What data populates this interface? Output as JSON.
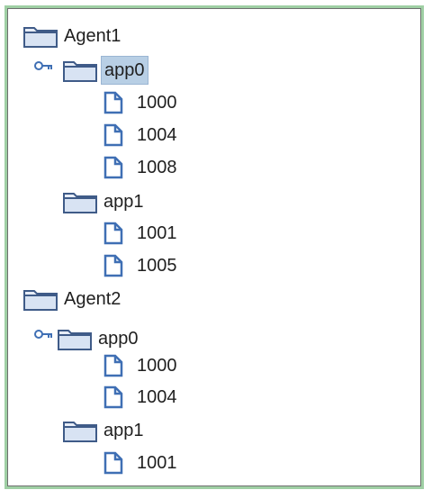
{
  "tree": {
    "agents": [
      {
        "label": "Agent1",
        "apps": [
          {
            "label": "app0",
            "selected": true,
            "files": [
              "1000",
              "1004",
              "1008"
            ]
          },
          {
            "label": "app1",
            "selected": false,
            "files": [
              "1001",
              "1005"
            ]
          }
        ]
      },
      {
        "label": "Agent2",
        "apps": [
          {
            "label": "app0",
            "selected": false,
            "files": [
              "1000",
              "1004"
            ]
          },
          {
            "label": "app1",
            "selected": false,
            "files": [
              "1001"
            ]
          }
        ]
      }
    ]
  },
  "icons": {
    "folder": "folder-icon",
    "file": "file-icon",
    "expand_handle": "key-handle-icon"
  },
  "colors": {
    "frame_border": "#9fcfa4",
    "selection_bg": "#b8cfe5",
    "icon_blue": "#3f6fb4"
  }
}
